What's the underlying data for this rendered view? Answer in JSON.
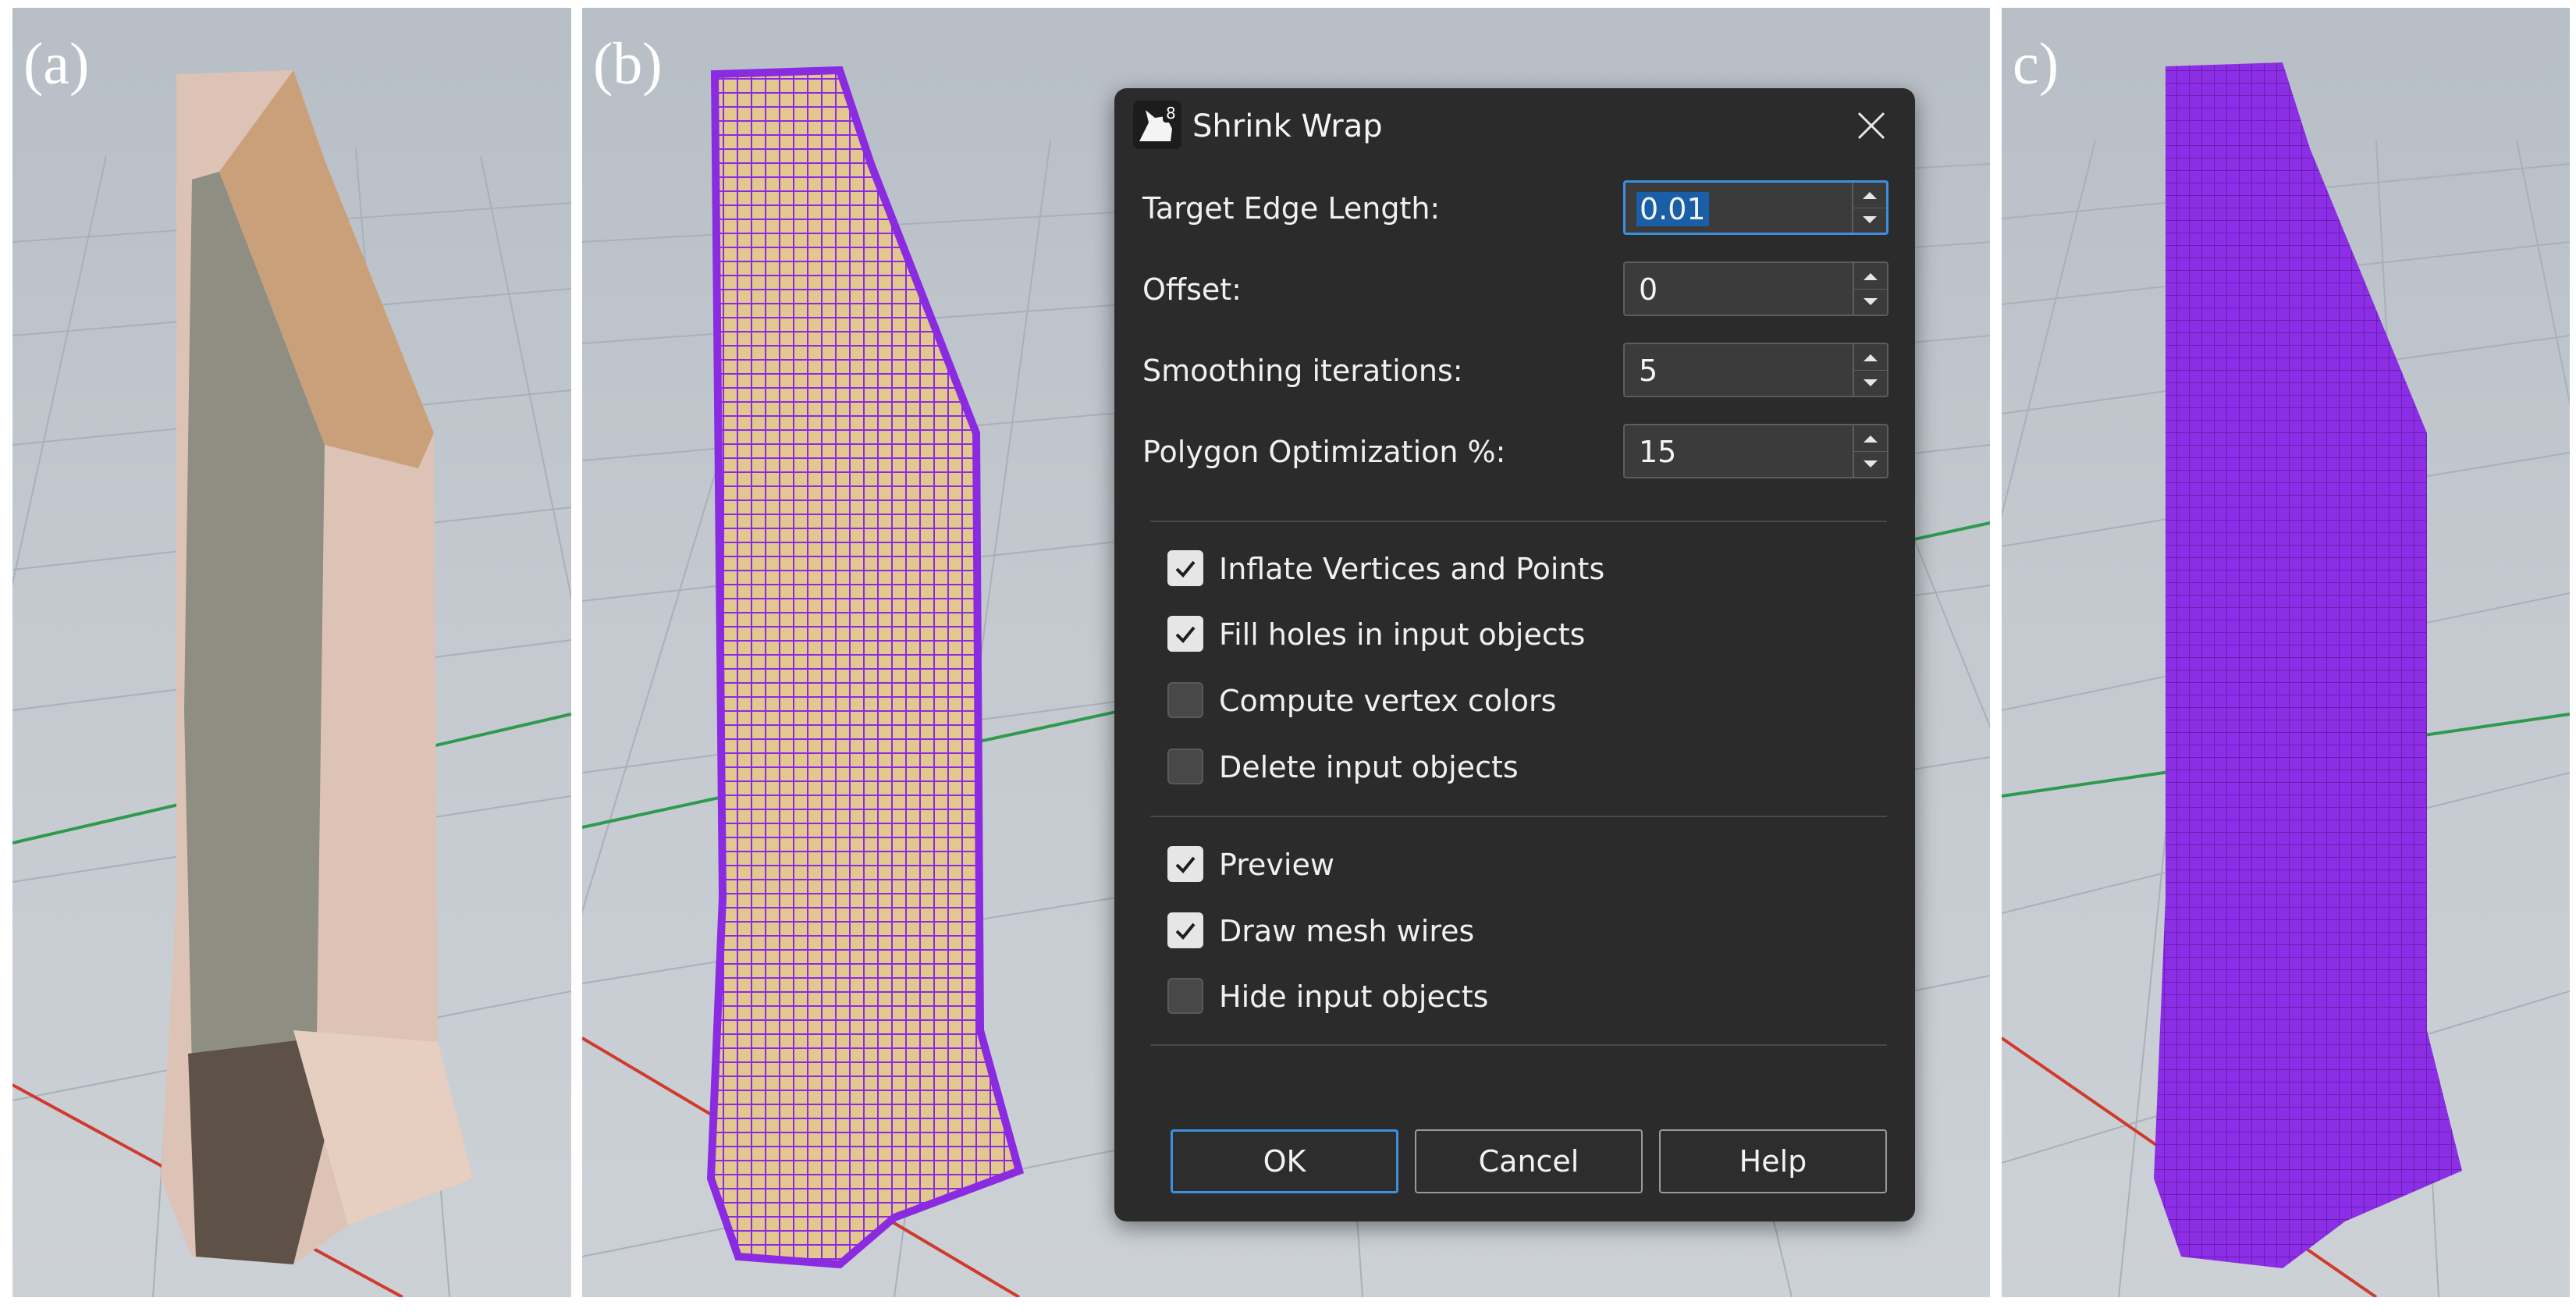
{
  "panels": {
    "a": {
      "label": "(a)"
    },
    "b": {
      "label": "(b)"
    },
    "c": {
      "label": "c)"
    }
  },
  "dialog": {
    "title": "Shrink Wrap",
    "app_icon_badge": "8",
    "fields": [
      {
        "label": "Target Edge Length:",
        "value": "0.01",
        "selected": true
      },
      {
        "label": "Offset:",
        "value": "0"
      },
      {
        "label": "Smoothing iterations:",
        "value": "5"
      },
      {
        "label": "Polygon Optimization %:",
        "value": "15"
      }
    ],
    "options": [
      {
        "label": "Inflate Vertices and Points",
        "checked": true
      },
      {
        "label": "Fill holes in input objects",
        "checked": true
      },
      {
        "label": "Compute vertex colors",
        "checked": false
      },
      {
        "label": "Delete input objects",
        "checked": false
      }
    ],
    "display": [
      {
        "label": "Preview",
        "checked": true
      },
      {
        "label": "Draw mesh wires",
        "checked": true
      },
      {
        "label": "Hide input objects",
        "checked": false
      }
    ],
    "buttons": {
      "ok": "OK",
      "cancel": "Cancel",
      "help": "Help"
    }
  },
  "colors": {
    "dialog_bg": "#2b2b2b",
    "accent": "#3d8fe0",
    "mesh_purple": "#8a2be2",
    "grid_x_axis": "#d03a2e",
    "grid_y_axis": "#2e9a4e",
    "point_cloud": "#e8c8b8"
  }
}
